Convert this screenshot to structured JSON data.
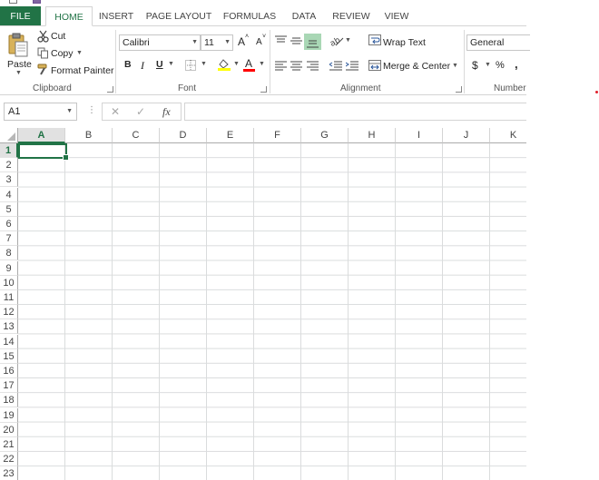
{
  "tabs": [
    "FILE",
    "HOME",
    "INSERT",
    "PAGE LAYOUT",
    "FORMULAS",
    "DATA",
    "REVIEW",
    "VIEW"
  ],
  "active_tab": "HOME",
  "clipboard": {
    "paste": "Paste",
    "cut": "Cut",
    "copy": "Copy",
    "format_painter": "Format Painter",
    "label": "Clipboard"
  },
  "font": {
    "family": "Calibri",
    "size": "11",
    "bold": "B",
    "italic": "I",
    "underline": "U",
    "grow": "A",
    "shrink": "A",
    "font_color_letter": "A",
    "label": "Font"
  },
  "alignment": {
    "wrap_text": "Wrap Text",
    "merge_center": "Merge & Center",
    "label": "Alignment"
  },
  "number": {
    "format": "General",
    "currency": "$",
    "percent": "%",
    "comma": ",",
    "label": "Number"
  },
  "formula_bar": {
    "name_box": "A1",
    "fx": "fx",
    "value": ""
  },
  "columns": [
    "A",
    "B",
    "C",
    "D",
    "E",
    "F",
    "G",
    "H",
    "I",
    "J",
    "K"
  ],
  "rows": [
    "1",
    "2",
    "3",
    "4",
    "5",
    "6",
    "7",
    "8",
    "9",
    "10",
    "11",
    "12",
    "13",
    "14",
    "15",
    "16",
    "17",
    "18",
    "19",
    "20",
    "21",
    "22",
    "23"
  ],
  "selected_cell": "A1",
  "colors": {
    "accent": "#217346",
    "highlight_yellow": "#ffff00",
    "font_red": "#ff0000"
  }
}
